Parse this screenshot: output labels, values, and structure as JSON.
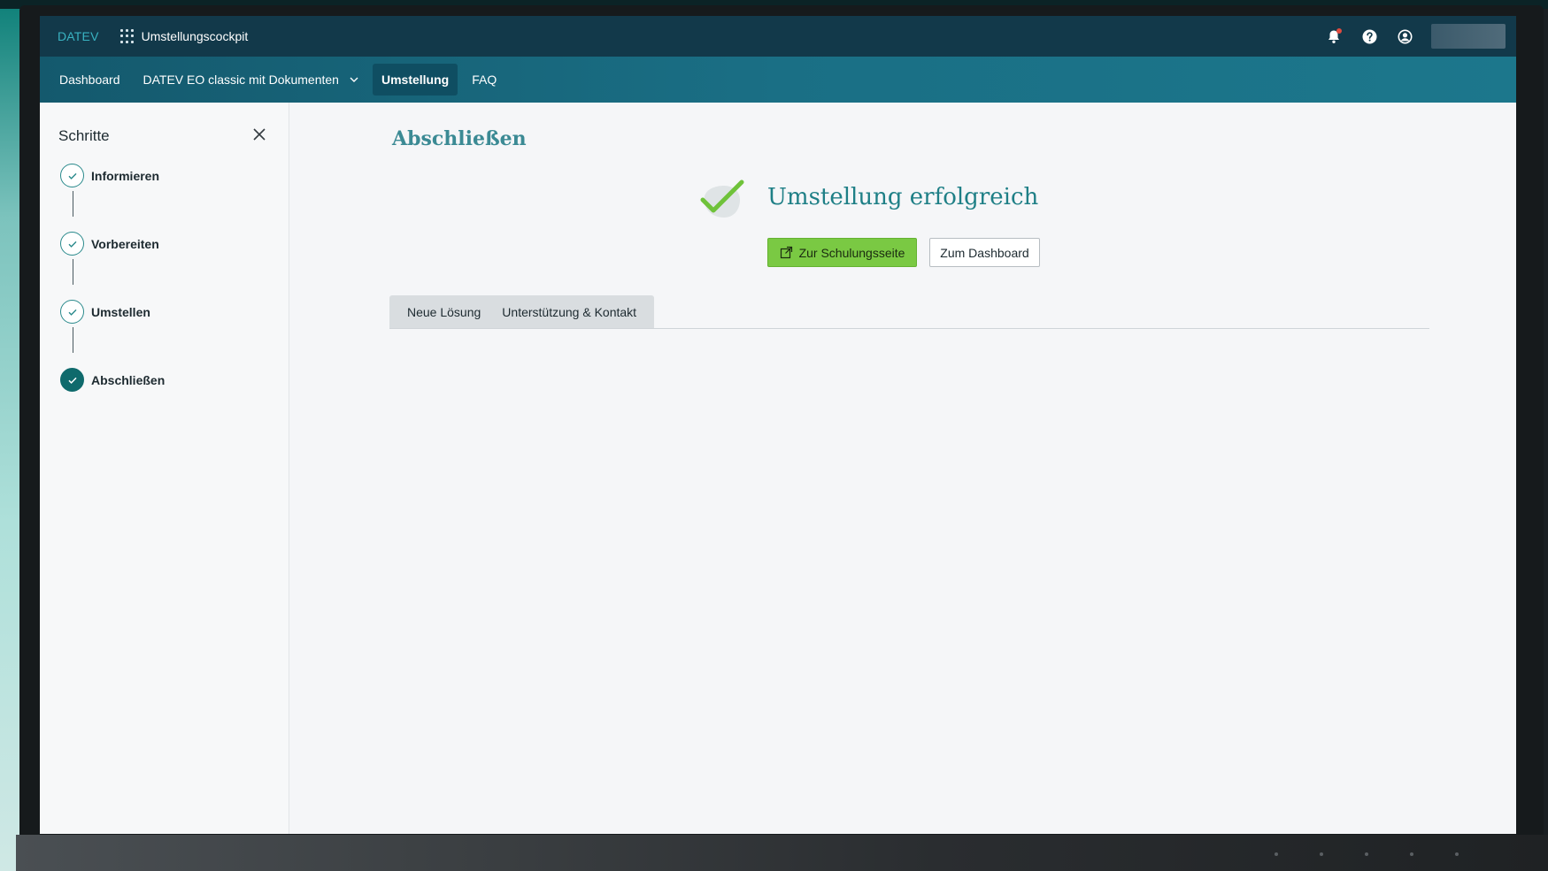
{
  "header": {
    "brand": "DATEV",
    "app_name": "Umstellungscockpit",
    "icons": [
      "apps-grid-icon",
      "bell-icon",
      "help-icon",
      "user-icon"
    ]
  },
  "nav": {
    "items": [
      {
        "label": "Dashboard",
        "active": false
      },
      {
        "label": "DATEV EO classic mit Dokumenten",
        "active": false,
        "has_dropdown": true
      },
      {
        "label": "Umstellung",
        "active": true
      },
      {
        "label": "FAQ",
        "active": false
      }
    ]
  },
  "sidebar": {
    "title": "Schritte",
    "steps": [
      {
        "label": "Informieren",
        "state": "done"
      },
      {
        "label": "Vorbereiten",
        "state": "done"
      },
      {
        "label": "Umstellen",
        "state": "done"
      },
      {
        "label": "Abschließen",
        "state": "current"
      }
    ]
  },
  "main": {
    "page_title": "Abschließen",
    "success_message": "Umstellung erfolgreich",
    "primary_button": "Zur Schulungsseite",
    "secondary_button": "Zum Dashboard",
    "tabs": [
      {
        "label": "Neue Lösung"
      },
      {
        "label": "Unterstützung & Kontakt"
      }
    ]
  },
  "colors": {
    "topbar": "#12394a",
    "navbar": "#1a6f85",
    "accent_teal": "#1e7f86",
    "primary_green": "#7ac943",
    "notification": "#e04b3f"
  }
}
